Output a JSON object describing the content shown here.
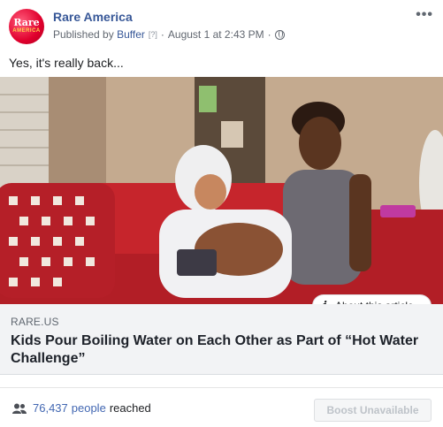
{
  "post": {
    "page_name": "Rare America",
    "avatar": {
      "line1": "Rare",
      "line2": "AMERICA"
    },
    "published_by_prefix": "Published by",
    "publisher": "Buffer",
    "help_marker": "[?]",
    "separator": "·",
    "timestamp": "August 1 at 2:43 PM",
    "more_label": "•••",
    "text": "Yes, it's really back..."
  },
  "link_preview": {
    "about_label": "About this article",
    "domain": "RARE.US",
    "headline": "Kids Pour Boiling Water on Each Other as Part of “Hot Water Challenge”"
  },
  "footer": {
    "reach_count": "76,437",
    "reach_people": "people",
    "reach_suffix": "reached",
    "boost_label": "Boost Unavailable"
  },
  "colors": {
    "link_blue": "#385898",
    "accent_blue": "#4267b2",
    "avatar_red": "#e0002d"
  },
  "icons": {
    "more": "ellipsis-icon",
    "audience": "globe-icon",
    "about": "info-icon",
    "reach": "people-icon"
  }
}
